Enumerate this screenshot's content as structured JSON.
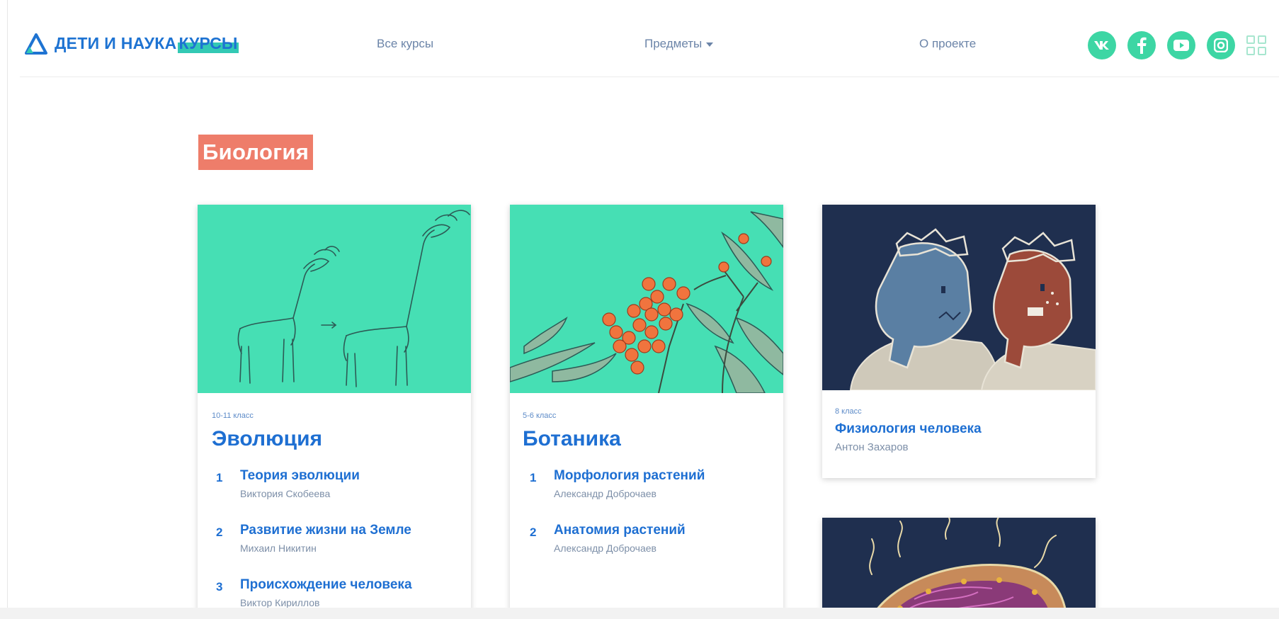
{
  "brand": {
    "name": "ДЕТИ И НАУКА",
    "highlight": "КУРСЫ",
    "colors": {
      "primary": "#1e73d2",
      "accent": "#33c9b4",
      "social": "#3dd6a4",
      "section": "#ee7d6a"
    }
  },
  "nav": {
    "all_courses": "Все курсы",
    "subjects": "Предметы",
    "about": "О проекте"
  },
  "socials": [
    {
      "name": "vk-icon",
      "glyph": "vk"
    },
    {
      "name": "facebook-icon",
      "glyph": "f"
    },
    {
      "name": "youtube-icon",
      "glyph": "play"
    },
    {
      "name": "instagram-icon",
      "glyph": "camera"
    },
    {
      "name": "apps-grid-icon",
      "glyph": "grid"
    }
  ],
  "section": {
    "title": "Биология"
  },
  "courses": [
    {
      "grade": "10-11 класс",
      "title": "Эволюция",
      "lessons": [
        {
          "num": "1",
          "title": "Теория эволюции",
          "author": "Виктория Скобеева"
        },
        {
          "num": "2",
          "title": "Развитие жизни на Земле",
          "author": "Михаил Никитин"
        },
        {
          "num": "3",
          "title": "Происхождение человека",
          "author": "Виктор Кириллов"
        }
      ]
    },
    {
      "grade": "5-6 класс",
      "title": "Ботаника",
      "lessons": [
        {
          "num": "1",
          "title": "Морфология растений",
          "author": "Александр Доброчаев"
        },
        {
          "num": "2",
          "title": "Анатомия растений",
          "author": "Александр Доброчаев"
        }
      ]
    },
    {
      "grade": "8 класс",
      "title": "Физиология человека",
      "author": "Антон Захаров"
    }
  ]
}
